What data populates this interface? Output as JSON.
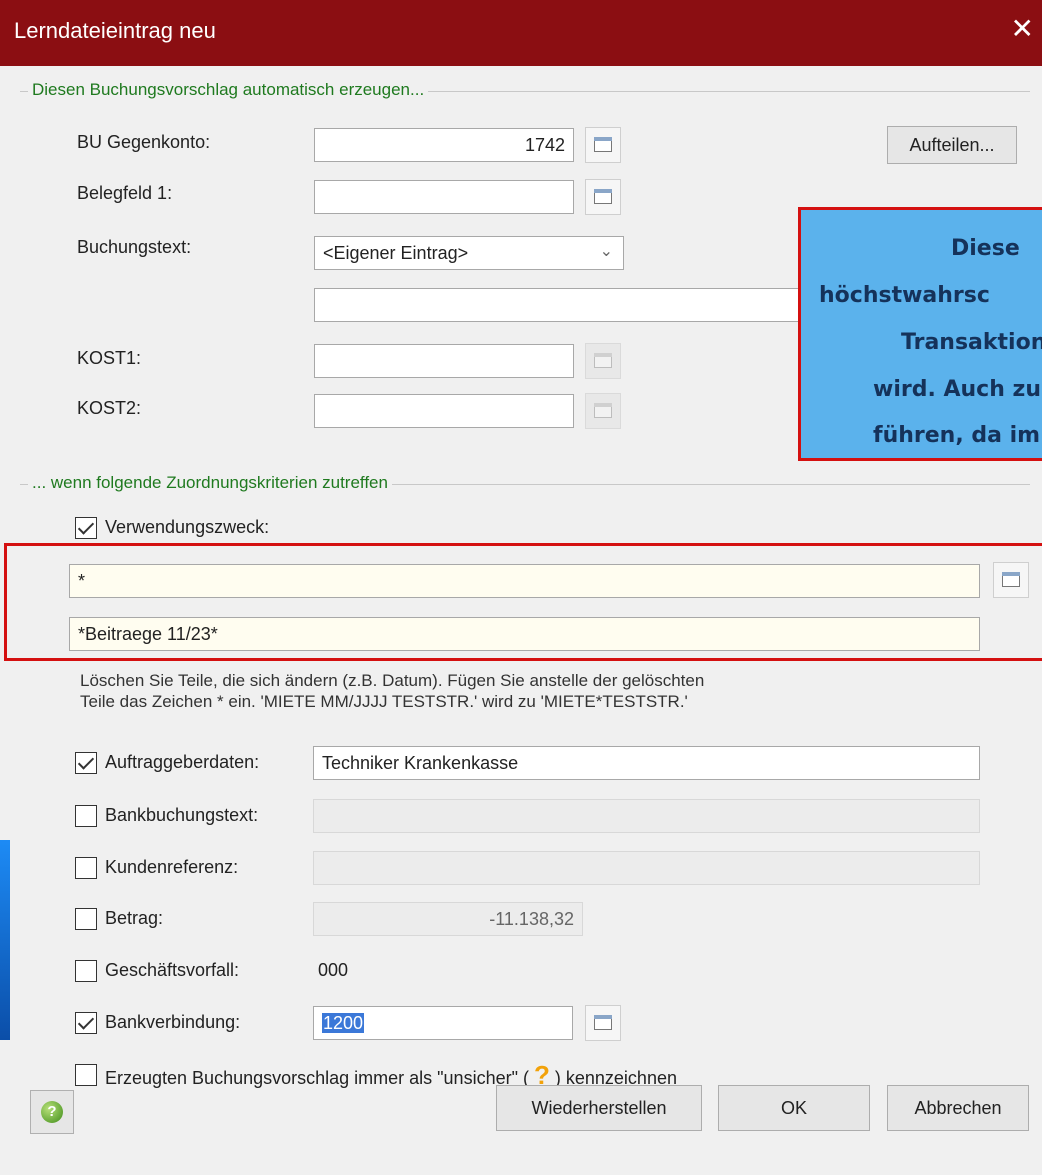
{
  "window": {
    "title": "Lerndateieintrag neu",
    "close_glyph": "✕"
  },
  "section_generate": {
    "legend": "Diesen Buchungsvorschlag automatisch erzeugen...",
    "bu_gegenkonto": {
      "label": "BU Gegenkonto:",
      "value": "1742"
    },
    "belegfeld1": {
      "label": "Belegfeld 1:",
      "value": ""
    },
    "buchungstext": {
      "label": "Buchungstext:",
      "selected": "<Eigener Eintrag>",
      "free_text": ""
    },
    "kost1": {
      "label": "KOST1:",
      "value": ""
    },
    "kost2": {
      "label": "KOST2:",
      "value": ""
    },
    "aufteilen_button": "Aufteilen..."
  },
  "callout": {
    "lines": [
      "Diese",
      "höchstwahrsc",
      "Transaktion",
      "wird. Auch zu",
      "führen, da im"
    ],
    "bg_color": "#5bb2ec",
    "border_color": "#d41010"
  },
  "section_criteria": {
    "legend": "... wenn folgende Zuordnungskriterien zutreffen",
    "verwendungszweck": {
      "label": "Verwendungszweck:",
      "checked": true,
      "line1": "*",
      "line2": "*Beitraege 11/23*"
    },
    "hint_line1": "Löschen Sie Teile, die sich ändern (z.B. Datum). Fügen Sie anstelle der gelöschten",
    "hint_line2": "Teile das Zeichen * ein. 'MIETE MM/JJJJ TESTSTR.' wird zu 'MIETE*TESTSTR.'",
    "auftraggeberdaten": {
      "label": "Auftraggeberdaten:",
      "checked": true,
      "value": "Techniker Krankenkasse"
    },
    "bankbuchungstext": {
      "label": "Bankbuchungstext:",
      "checked": false,
      "value": ""
    },
    "kundenreferenz": {
      "label": "Kundenreferenz:",
      "checked": false,
      "value": ""
    },
    "betrag": {
      "label": "Betrag:",
      "checked": false,
      "value": "-11.138,32"
    },
    "geschaeftsvorfall": {
      "label": "Geschäftsvorfall:",
      "checked": false,
      "value": "000"
    },
    "bankverbindung": {
      "label": "Bankverbindung:",
      "checked": true,
      "value": "1200"
    },
    "unsicher": {
      "label_before": "Erzeugten Buchungsvorschlag immer als \"unsicher\" (",
      "icon_glyph": "?",
      "label_after": ") kennzeichnen",
      "checked": false
    }
  },
  "footer": {
    "help_glyph": "?",
    "wiederherstellen": "Wiederherstellen",
    "ok": "OK",
    "abbrechen": "Abbrechen"
  }
}
